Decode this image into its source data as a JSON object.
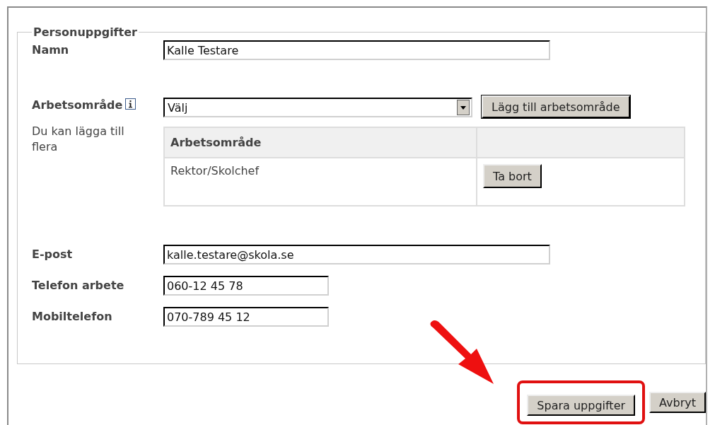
{
  "fieldset": {
    "legend": "Personuppgifter"
  },
  "name_field": {
    "label": "Namn",
    "value": "Kalle Testare"
  },
  "work_area": {
    "label": "Arbetsområde",
    "select_value": "Välj",
    "add_button": "Lägg till arbetsområde",
    "hint": "Du kan lägga till flera",
    "table": {
      "columns": [
        "Arbetsområde"
      ],
      "rows": [
        {
          "area": "Rektor/Skolchef",
          "remove_button": "Ta bort"
        }
      ]
    }
  },
  "contact_fields": [
    {
      "label": "E-post",
      "value": "kalle.testare@skola.se",
      "kind": "wide"
    },
    {
      "label": "Telefon arbete",
      "value": "060-12 45 78",
      "kind": "short"
    },
    {
      "label": "Mobiltelefon",
      "value": "070-789 45 12",
      "kind": "short"
    }
  ],
  "buttons": [
    {
      "label": "Spara uppgifter",
      "highlighted": true
    },
    {
      "label": "Avbryt",
      "highlighted": false
    }
  ]
}
